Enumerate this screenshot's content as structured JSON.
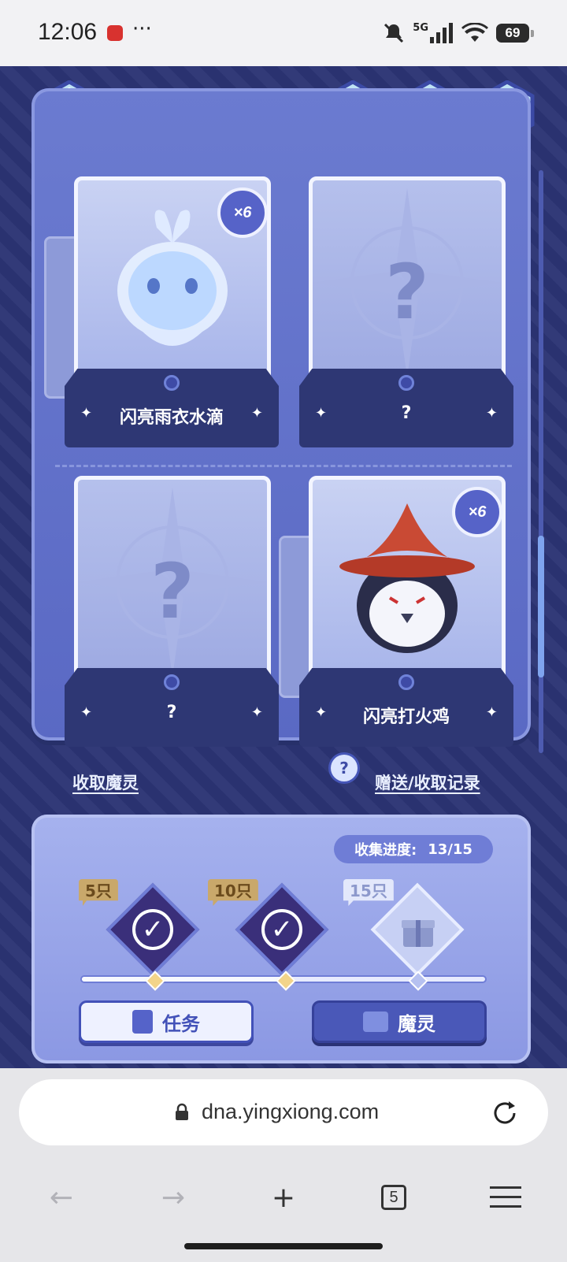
{
  "status_bar": {
    "time": "12:06",
    "more": "···",
    "battery": "69",
    "network": "5G"
  },
  "top_buttons": [
    {
      "icon": "home-icon"
    },
    {
      "icon": "help-icon"
    },
    {
      "icon": "music-icon"
    },
    {
      "icon": "share-icon"
    }
  ],
  "cards": [
    {
      "name": "闪亮雨衣水滴",
      "count": "×6",
      "known": true
    },
    {
      "name": "?",
      "known": false
    },
    {
      "name": "?",
      "known": false
    },
    {
      "name": "闪亮打火鸡",
      "count": "×6",
      "known": true
    }
  ],
  "unknown_mark": "?",
  "links": {
    "collect": "收取魔灵",
    "help": "?",
    "records": "赠送/收取记录"
  },
  "progress": {
    "label": "收集进度:",
    "value": "13/15",
    "milestones": [
      {
        "tag": "5只",
        "claimed": true
      },
      {
        "tag": "10只",
        "claimed": true
      },
      {
        "tag": "15只",
        "claimed": false
      }
    ]
  },
  "buttons": {
    "task": "任务",
    "spirit": "魔灵"
  },
  "browser": {
    "url": "dna.yingxiong.com",
    "tab_count": "5"
  }
}
